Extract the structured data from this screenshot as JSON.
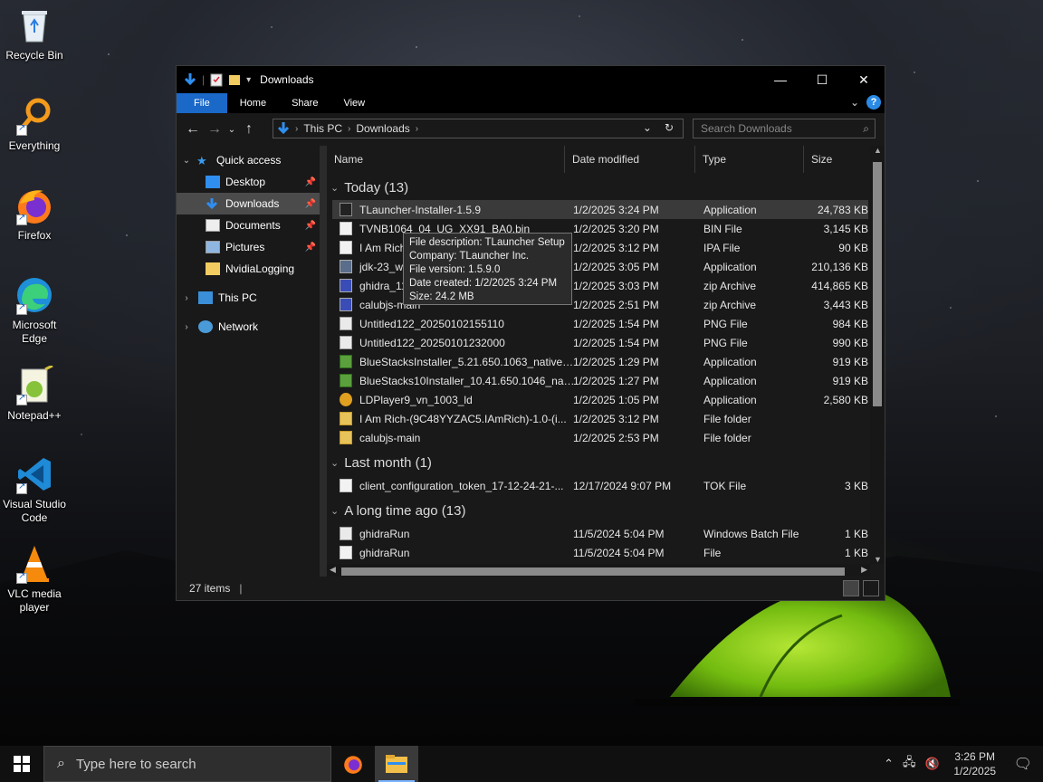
{
  "desktop": {
    "icons": [
      {
        "label": "Recycle Bin"
      },
      {
        "label": "Everything"
      },
      {
        "label": "Firefox"
      },
      {
        "label": "Microsoft Edge"
      },
      {
        "label": "Notepad++"
      },
      {
        "label": "Visual Studio Code"
      },
      {
        "label": "VLC media player"
      }
    ]
  },
  "window": {
    "title": "Downloads",
    "ribbon_tabs": {
      "file": "File",
      "home": "Home",
      "share": "Share",
      "view": "View"
    },
    "help": "?",
    "address": {
      "root": "This PC",
      "folder": "Downloads"
    },
    "search_placeholder": "Search Downloads",
    "nav": {
      "quick_access": "Quick access",
      "desktop": "Desktop",
      "downloads": "Downloads",
      "documents": "Documents",
      "pictures": "Pictures",
      "nvidia": "NvidiaLogging",
      "this_pc": "This PC",
      "network": "Network"
    },
    "columns": {
      "name": "Name",
      "date": "Date modified",
      "type": "Type",
      "size": "Size"
    },
    "groups": {
      "today": "Today (13)",
      "last_month": "Last month (1)",
      "long_ago": "A long time ago (13)"
    },
    "files_today": [
      {
        "name": "TLauncher-Installer-1.5.9",
        "date": "1/2/2025 3:24 PM",
        "type": "Application",
        "size": "24,783 KB",
        "icon": "tl"
      },
      {
        "name": "TVNB1064_04_UG_XX91_BA0.bin",
        "date": "1/2/2025 3:20 PM",
        "type": "BIN File",
        "size": "3,145 KB",
        "icon": "doc"
      },
      {
        "name": "I Am Rich",
        "date": "1/2/2025 3:12 PM",
        "type": "IPA File",
        "size": "90 KB",
        "icon": "doc"
      },
      {
        "name": "jdk-23_wi",
        "date": "1/2/2025 3:05 PM",
        "type": "Application",
        "size": "210,136 KB",
        "icon": "app"
      },
      {
        "name": "ghidra_11",
        "date": "1/2/2025 3:03 PM",
        "type": "zip Archive",
        "size": "414,865 KB",
        "icon": "zip"
      },
      {
        "name": "calubjs-main",
        "date": "1/2/2025 2:51 PM",
        "type": "zip Archive",
        "size": "3,443 KB",
        "icon": "zip"
      },
      {
        "name": "Untitled122_20250102155110",
        "date": "1/2/2025 1:54 PM",
        "type": "PNG File",
        "size": "984 KB",
        "icon": "png"
      },
      {
        "name": "Untitled122_20250101232000",
        "date": "1/2/2025 1:54 PM",
        "type": "PNG File",
        "size": "990 KB",
        "icon": "png"
      },
      {
        "name": "BlueStacksInstaller_5.21.650.1063_native_...",
        "date": "1/2/2025 1:29 PM",
        "type": "Application",
        "size": "919 KB",
        "icon": "blue"
      },
      {
        "name": "BlueStacks10Installer_10.41.650.1046_nati...",
        "date": "1/2/2025 1:27 PM",
        "type": "Application",
        "size": "919 KB",
        "icon": "blue"
      },
      {
        "name": "LDPlayer9_vn_1003_ld",
        "date": "1/2/2025 1:05 PM",
        "type": "Application",
        "size": "2,580 KB",
        "icon": "ld"
      },
      {
        "name": "I Am Rich-(9C48YYZAC5.IAmRich)-1.0-(i...",
        "date": "1/2/2025 3:12 PM",
        "type": "File folder",
        "size": "",
        "icon": "folder"
      },
      {
        "name": "calubjs-main",
        "date": "1/2/2025 2:53 PM",
        "type": "File folder",
        "size": "",
        "icon": "folder"
      }
    ],
    "files_last_month": [
      {
        "name": "client_configuration_token_17-12-24-21-...",
        "date": "12/17/2024 9:07 PM",
        "type": "TOK File",
        "size": "3 KB",
        "icon": "doc"
      }
    ],
    "files_long_ago": [
      {
        "name": "ghidraRun",
        "date": "11/5/2024 5:04 PM",
        "type": "Windows Batch File",
        "size": "1 KB",
        "icon": "png"
      },
      {
        "name": "ghidraRun",
        "date": "11/5/2024 5:04 PM",
        "type": "File",
        "size": "1 KB",
        "icon": "doc"
      }
    ],
    "tooltip": {
      "line1": "File description: TLauncher Setup",
      "line2": "Company: TLauncher Inc.",
      "line3": "File version: 1.5.9.0",
      "line4": "Date created: 1/2/2025 3:24 PM",
      "line5": "Size: 24.2 MB"
    },
    "status": "27 items"
  },
  "taskbar": {
    "search_placeholder": "Type here to search",
    "time": "3:26 PM",
    "date": "1/2/2025"
  },
  "colors": {
    "accent": "#1a68c8",
    "window_bg": "#191919",
    "selected_row": "#3a3a3a"
  }
}
